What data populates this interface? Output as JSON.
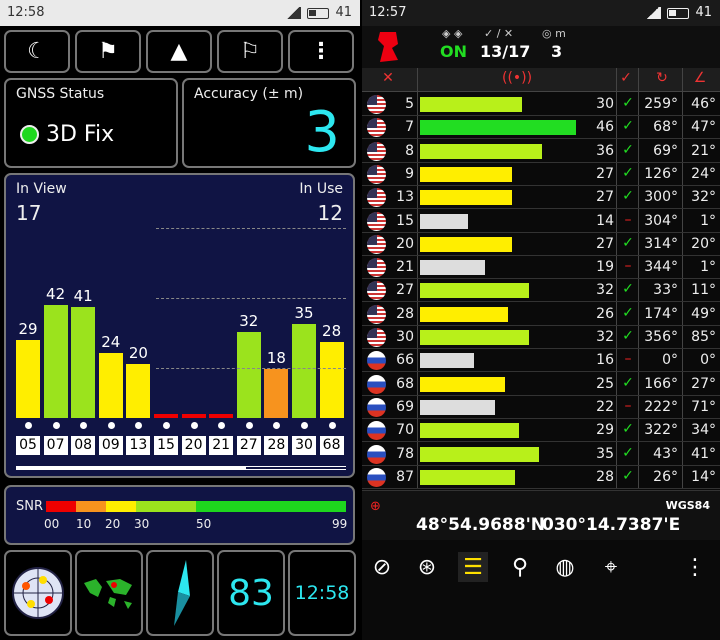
{
  "left": {
    "status_time": "12:58",
    "battery": "41",
    "toolbar": [
      "moon-icon",
      "people-icon",
      "navigate-icon",
      "flags-icon",
      "more-icon"
    ],
    "gnss_status": {
      "label": "GNSS Status",
      "value": "3D Fix"
    },
    "accuracy": {
      "label": "Accuracy (± m)",
      "value": "3"
    },
    "in_view": {
      "label": "In View",
      "value": "17"
    },
    "in_use": {
      "label": "In Use",
      "value": "12"
    },
    "snr": {
      "label": "SNR",
      "ticks": [
        "00",
        "10",
        "20",
        "30",
        "50",
        "99"
      ]
    },
    "bottom": {
      "sat_count": "83",
      "clock": "12:58"
    }
  },
  "right": {
    "status_time": "12:57",
    "battery": "41",
    "header": {
      "state": "ON",
      "sats": "13/17",
      "m_value": "3"
    },
    "datum": "WGS84",
    "lat": "48°54.9688'N",
    "lon": "030°14.7387'E",
    "rows": [
      {
        "prn": "5",
        "snr": "30",
        "az": "259°",
        "el": "46°"
      },
      {
        "prn": "7",
        "snr": "46",
        "az": "68°",
        "el": "47°"
      },
      {
        "prn": "8",
        "snr": "36",
        "az": "69°",
        "el": "21°"
      },
      {
        "prn": "9",
        "snr": "27",
        "az": "126°",
        "el": "24°"
      },
      {
        "prn": "13",
        "snr": "27",
        "az": "300°",
        "el": "32°"
      },
      {
        "prn": "15",
        "snr": "14",
        "az": "304°",
        "el": "1°"
      },
      {
        "prn": "20",
        "snr": "27",
        "az": "314°",
        "el": "20°"
      },
      {
        "prn": "21",
        "snr": "19",
        "az": "344°",
        "el": "1°"
      },
      {
        "prn": "27",
        "snr": "32",
        "az": "33°",
        "el": "11°"
      },
      {
        "prn": "28",
        "snr": "26",
        "az": "174°",
        "el": "49°"
      },
      {
        "prn": "30",
        "snr": "32",
        "az": "356°",
        "el": "85°"
      },
      {
        "prn": "66",
        "snr": "16",
        "az": "0°",
        "el": "0°"
      },
      {
        "prn": "68",
        "snr": "25",
        "az": "166°",
        "el": "27°"
      },
      {
        "prn": "69",
        "snr": "22",
        "az": "222°",
        "el": "71°"
      },
      {
        "prn": "70",
        "snr": "29",
        "az": "322°",
        "el": "34°"
      },
      {
        "prn": "78",
        "snr": "35",
        "az": "43°",
        "el": "41°"
      },
      {
        "prn": "87",
        "snr": "28",
        "az": "26°",
        "el": "14°"
      }
    ]
  },
  "chart_data": {
    "type": "bar",
    "categories": [
      "05",
      "07",
      "08",
      "09",
      "13",
      "15",
      "20",
      "21",
      "27",
      "28",
      "30",
      "68"
    ],
    "values": [
      29,
      42,
      41,
      24,
      20,
      0,
      0,
      0,
      32,
      18,
      35,
      28
    ],
    "ylabel": ""
  }
}
